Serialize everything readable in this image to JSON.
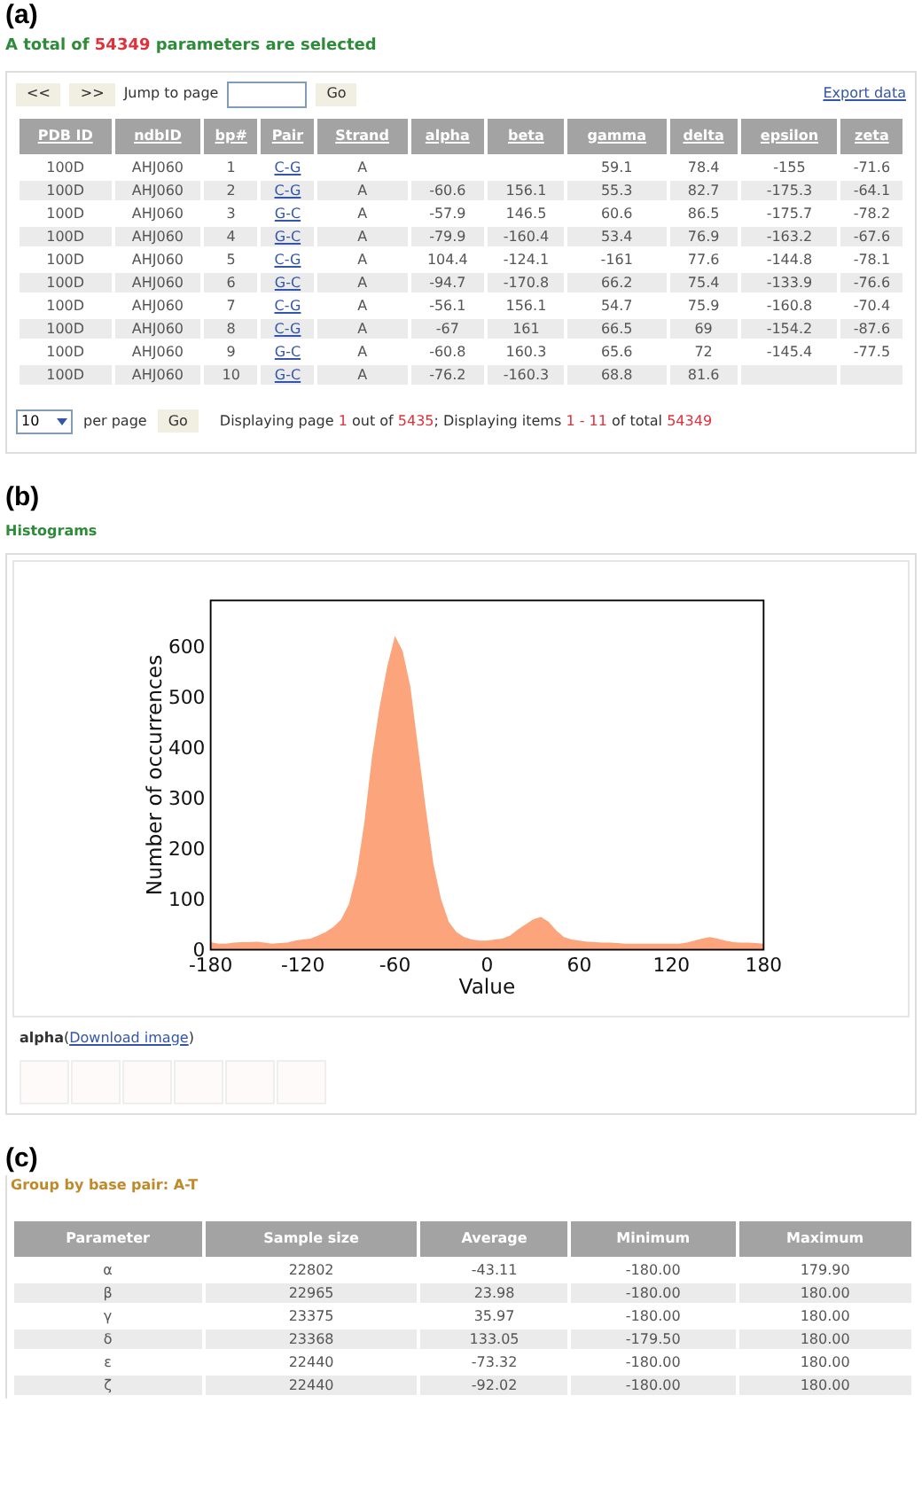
{
  "panel_a": {
    "label": "(a)",
    "summary": [
      {
        "kind": "plain",
        "text": "A total of "
      },
      {
        "kind": "highlight",
        "text": "54349"
      },
      {
        "kind": "plain",
        "text": " parameters are selected"
      }
    ],
    "pager": {
      "prev": "<<",
      "next": ">>",
      "jump_label": "Jump to page",
      "go": "Go",
      "export": "Export data"
    },
    "table": {
      "columns": [
        "PDB ID",
        "ndbID",
        "bp#",
        "Pair",
        "Strand",
        "alpha",
        "beta",
        "gamma",
        "delta",
        "epsilon",
        "zeta"
      ],
      "rows": [
        [
          "100D",
          "AHJ060",
          "1",
          "C-G",
          "A",
          "",
          "",
          "59.1",
          "78.4",
          "-155",
          "-71.6"
        ],
        [
          "100D",
          "AHJ060",
          "2",
          "C-G",
          "A",
          "-60.6",
          "156.1",
          "55.3",
          "82.7",
          "-175.3",
          "-64.1"
        ],
        [
          "100D",
          "AHJ060",
          "3",
          "G-C",
          "A",
          "-57.9",
          "146.5",
          "60.6",
          "86.5",
          "-175.7",
          "-78.2"
        ],
        [
          "100D",
          "AHJ060",
          "4",
          "G-C",
          "A",
          "-79.9",
          "-160.4",
          "53.4",
          "76.9",
          "-163.2",
          "-67.6"
        ],
        [
          "100D",
          "AHJ060",
          "5",
          "C-G",
          "A",
          "104.4",
          "-124.1",
          "-161",
          "77.6",
          "-144.8",
          "-78.1"
        ],
        [
          "100D",
          "AHJ060",
          "6",
          "G-C",
          "A",
          "-94.7",
          "-170.8",
          "66.2",
          "75.4",
          "-133.9",
          "-76.6"
        ],
        [
          "100D",
          "AHJ060",
          "7",
          "C-G",
          "A",
          "-56.1",
          "156.1",
          "54.7",
          "75.9",
          "-160.8",
          "-70.4"
        ],
        [
          "100D",
          "AHJ060",
          "8",
          "C-G",
          "A",
          "-67",
          "161",
          "66.5",
          "69",
          "-154.2",
          "-87.6"
        ],
        [
          "100D",
          "AHJ060",
          "9",
          "G-C",
          "A",
          "-60.8",
          "160.3",
          "65.6",
          "72",
          "-145.4",
          "-77.5"
        ],
        [
          "100D",
          "AHJ060",
          "10",
          "G-C",
          "A",
          "-76.2",
          "-160.3",
          "68.8",
          "81.6",
          "",
          ""
        ]
      ]
    },
    "footer": {
      "per_page_value": "10",
      "per_page_label": "per page",
      "go": "Go",
      "status": [
        {
          "kind": "plain",
          "text": "Displaying page "
        },
        {
          "kind": "highlight",
          "text": "1"
        },
        {
          "kind": "plain",
          "text": " out of "
        },
        {
          "kind": "highlight",
          "text": "5435"
        },
        {
          "kind": "plain",
          "text": "; Displaying items "
        },
        {
          "kind": "highlight",
          "text": "1 - 11"
        },
        {
          "kind": "plain",
          "text": " of total "
        },
        {
          "kind": "highlight",
          "text": "54349"
        }
      ]
    }
  },
  "panel_b": {
    "label": "(b)",
    "title": "Histograms",
    "chart_data": {
      "type": "area",
      "xlabel": "Value",
      "ylabel": "Number of occurrences",
      "xlim": [
        -180,
        180
      ],
      "ylim": [
        0,
        690
      ],
      "xticks": [
        -180,
        -120,
        -60,
        0,
        60,
        120,
        180
      ],
      "yticks": [
        0,
        100,
        200,
        300,
        400,
        500,
        600
      ],
      "x": [
        -180,
        -175,
        -170,
        -165,
        -160,
        -155,
        -150,
        -145,
        -140,
        -135,
        -130,
        -125,
        -120,
        -115,
        -110,
        -105,
        -100,
        -95,
        -90,
        -85,
        -80,
        -75,
        -70,
        -65,
        -60,
        -55,
        -50,
        -45,
        -40,
        -35,
        -30,
        -25,
        -20,
        -15,
        -10,
        -5,
        0,
        5,
        10,
        15,
        20,
        25,
        30,
        35,
        40,
        45,
        50,
        55,
        60,
        65,
        70,
        75,
        80,
        85,
        90,
        95,
        100,
        105,
        110,
        115,
        120,
        125,
        130,
        135,
        140,
        145,
        150,
        155,
        160,
        165,
        170,
        175,
        180
      ],
      "series": [
        {
          "color": "#fca47c",
          "values": [
            15,
            12,
            12,
            14,
            15,
            15,
            16,
            14,
            12,
            13,
            14,
            18,
            20,
            22,
            28,
            35,
            45,
            60,
            90,
            150,
            250,
            380,
            480,
            560,
            620,
            590,
            520,
            400,
            280,
            170,
            100,
            55,
            35,
            25,
            20,
            18,
            18,
            20,
            22,
            28,
            40,
            50,
            60,
            65,
            55,
            38,
            25,
            20,
            18,
            16,
            15,
            14,
            14,
            13,
            12,
            12,
            12,
            12,
            12,
            12,
            12,
            12,
            14,
            18,
            22,
            25,
            22,
            18,
            15,
            14,
            14,
            13,
            12
          ]
        }
      ]
    },
    "caption_name": "alpha",
    "caption_open": "(",
    "caption_link": "Download image",
    "caption_close": ")"
  },
  "panel_c": {
    "label": "(c)",
    "title": "Group by base pair: A-T",
    "table": {
      "columns": [
        "Parameter",
        "Sample size",
        "Average",
        "Minimum",
        "Maximum"
      ],
      "rows": [
        [
          "α",
          "22802",
          "-43.11",
          "-180.00",
          "179.90"
        ],
        [
          "β",
          "22965",
          "23.98",
          "-180.00",
          "180.00"
        ],
        [
          "γ",
          "23375",
          "35.97",
          "-180.00",
          "180.00"
        ],
        [
          "δ",
          "23368",
          "133.05",
          "-179.50",
          "180.00"
        ],
        [
          "ε",
          "22440",
          "-73.32",
          "-180.00",
          "180.00"
        ],
        [
          "ζ",
          "22440",
          "-92.02",
          "-180.00",
          "180.00"
        ]
      ]
    }
  }
}
